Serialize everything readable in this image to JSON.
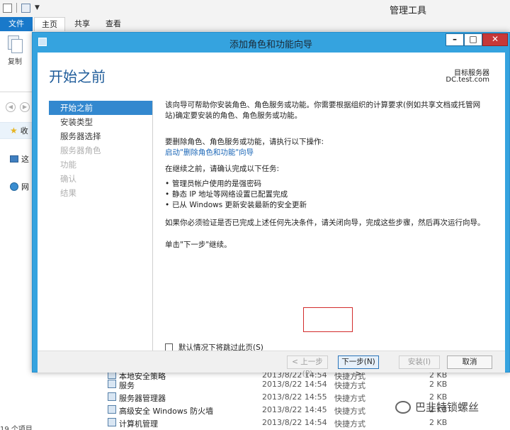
{
  "explorer": {
    "title": "管理工具",
    "tabs": [
      "文件",
      "主页",
      "共享",
      "查看"
    ],
    "ribbon": {
      "copy_label": "复制"
    },
    "nav": {
      "favorites": "收",
      "this_pc": "这",
      "network": "网"
    },
    "files": [
      {
        "name": "本地安全策略",
        "date": "2013/8/22 14:54",
        "type": "快捷方式",
        "size": "2 KB"
      },
      {
        "name": "服务",
        "date": "2013/8/22 14:54",
        "type": "快捷方式",
        "size": "2 KB"
      },
      {
        "name": "服务器管理器",
        "date": "2013/8/22 14:55",
        "type": "快捷方式",
        "size": "2 KB"
      },
      {
        "name": "高级安全 Windows 防火墙",
        "date": "2013/8/22 14:45",
        "type": "快捷方式",
        "size": "2 KB"
      },
      {
        "name": "计算机管理",
        "date": "2013/8/22 14:54",
        "type": "快捷方式",
        "size": "2 KB"
      }
    ],
    "status_count": "19 个项目"
  },
  "wizard": {
    "title": "添加角色和功能向导",
    "heading": "开始之前",
    "destination_label": "目标服务器",
    "destination_server": "DC.test.com",
    "steps": [
      {
        "label": "开始之前",
        "state": "active"
      },
      {
        "label": "安装类型",
        "state": "normal"
      },
      {
        "label": "服务器选择",
        "state": "normal"
      },
      {
        "label": "服务器角色",
        "state": "disabled"
      },
      {
        "label": "功能",
        "state": "disabled"
      },
      {
        "label": "确认",
        "state": "disabled"
      },
      {
        "label": "结果",
        "state": "disabled"
      }
    ],
    "content": {
      "intro": "该向导可帮助你安装角色、角色服务或功能。你需要根据组织的计算要求(例如共享文档或托管网站)确定要安装的角色、角色服务或功能。",
      "remove_label": "要删除角色、角色服务或功能，请执行以下操作:",
      "remove_link": "启动\"删除角色和功能\"向导",
      "confirm_label": "在继续之前，请确认完成以下任务:",
      "tasks": [
        "管理员帐户使用的是强密码",
        "静态 IP 地址等网络设置已配置完成",
        "已从 Windows 更新安装最新的安全更新"
      ],
      "verify_note": "如果你必须验证是否已完成上述任何先决条件，请关闭向导，完成这些步骤，然后再次运行向导。",
      "click_next": "单击\"下一步\"继续。"
    },
    "skip_label": "默认情况下将跳过此页(S)",
    "buttons": {
      "prev": "< 上一步(P)",
      "next": "下一步(N) >",
      "install": "安装(I)",
      "cancel": "取消"
    },
    "window_controls": {
      "minimize": "–",
      "maximize": "□",
      "close": "✕"
    }
  },
  "watermark": "巴韭特锁螺丝",
  "colors": {
    "wizard_frame": "#35a3df",
    "active_step": "#3388cf",
    "heading": "#1f5c9a",
    "link": "#1d68b8",
    "file_tab": "#1979ca",
    "highlight": "#d22c2c"
  }
}
